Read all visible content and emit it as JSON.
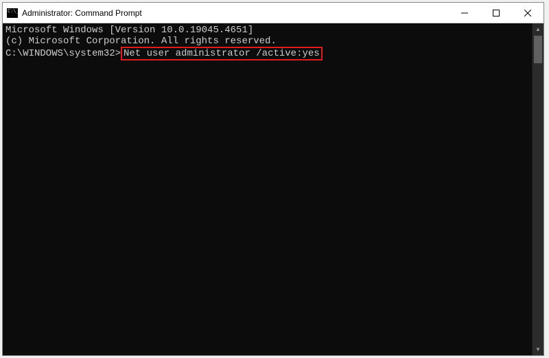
{
  "window": {
    "title": "Administrator: Command Prompt"
  },
  "terminal": {
    "line1": "Microsoft Windows [Version 10.0.19045.4651]",
    "line2": "(c) Microsoft Corporation. All rights reserved.",
    "blank": "",
    "prompt_prefix": "C:\\WINDOWS\\system32>",
    "command": "Net user administrator /active:yes"
  }
}
